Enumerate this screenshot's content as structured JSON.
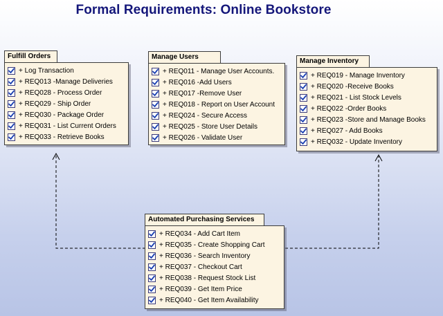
{
  "title": "Formal Requirements: Online Bookstore",
  "colors": {
    "title": "#14167a",
    "package_fill": "#fcf4e2",
    "checkmark": "#1a3fb0",
    "connector": "#000000"
  },
  "packages": {
    "fulfill_orders": {
      "name": "Fulfill Orders",
      "items": [
        "+ Log Transaction",
        "+ REQ013 -Manage Deliveries",
        "+ REQ028 - Process Order",
        "+ REQ029 - Ship Order",
        "+ REQ030 - Package Order",
        "+ REQ031 - List Current Orders",
        "+ REQ033 - Retrieve Books"
      ]
    },
    "manage_users": {
      "name": "Manage Users",
      "items": [
        "+ REQ011 - Manage User Accounts.",
        "+ REQ016 -Add Users",
        "+ REQ017 -Remove User",
        "+ REQ018 - Report on User Account",
        "+ REQ024 - Secure Access",
        "+ REQ025 - Store User Details",
        "+ REQ026 - Validate User"
      ]
    },
    "manage_inventory": {
      "name": "Manage Inventory",
      "items": [
        "+ REQ019 - Manage Inventory",
        "+ REQ020 -Receive Books",
        "+ REQ021 - List Stock Levels",
        "+ REQ022 -Order Books",
        "+ REQ023 -Store and Manage Books",
        "+ REQ027 - Add Books",
        "+ REQ032 - Update Inventory"
      ]
    },
    "automated_purchasing": {
      "name": "Automated Purchasing Services",
      "items": [
        "+ REQ034 - Add Cart Item",
        "+ REQ035 - Create Shopping Cart",
        "+ REQ036 - Search Inventory",
        "+ REQ037 - Checkout Cart",
        "+ REQ038 - Request Stock List",
        "+ REQ039 - Get Item Price",
        "+ REQ040 - Get Item Availability"
      ]
    }
  }
}
